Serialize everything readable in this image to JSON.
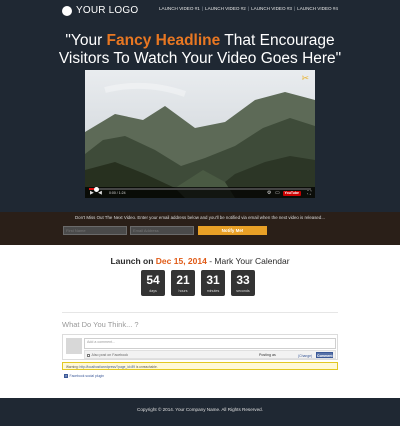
{
  "header": {
    "logo_text": "YOUR LOGO",
    "nav": [
      "LAUNCH VIDEO #1",
      "LAUNCH VIDEO #2",
      "LAUNCH VIDEO #3",
      "LAUNCH VIDEO #4"
    ],
    "nav_separator": "|"
  },
  "hero": {
    "headline_open": "\"Your ",
    "headline_accent": "Fancy Headline",
    "headline_rest": " That Encourage",
    "headline_line2": "Visitors To Watch Your Video Goes Here\"",
    "accent_color": "#e87722"
  },
  "video": {
    "time": "0:00 / 1:24",
    "progress_fraction": 0.03,
    "play_icon": "play-icon",
    "youtube_label": "YouTube"
  },
  "notify": {
    "message": "Don't Miss Out The Next Video. Enter your email address below and you'll be notified via email when the next video is released...",
    "first_name_placeholder": "First Name",
    "email_placeholder": "Email Address",
    "button_label": "Notify Me!",
    "button_color": "#e8a026"
  },
  "launch": {
    "prefix": "Launch on ",
    "date": "Dec 15, 2014",
    "suffix": " - Mark Your Calendar",
    "countdown": [
      {
        "value": "54",
        "label": "days"
      },
      {
        "value": "21",
        "label": "hours"
      },
      {
        "value": "31",
        "label": "minutes"
      },
      {
        "value": "33",
        "label": "seconds"
      }
    ]
  },
  "comments": {
    "title": "What Do You Think... ?",
    "input_placeholder": "Add a comment...",
    "also_post": "Also post on Facebook",
    "posting_as": "Posting as",
    "change": "(Change)",
    "comment_button": "Comment",
    "warning_prefix": "Warning: ",
    "warning_link": "http://localhost/wordpress/?page_id=89",
    "warning_suffix": " is unreachable.",
    "plugin_label": "Facebook social plugin"
  },
  "footer": {
    "copyright": "Copyright © 2014. Your Company Name. All Rights Reserved."
  }
}
